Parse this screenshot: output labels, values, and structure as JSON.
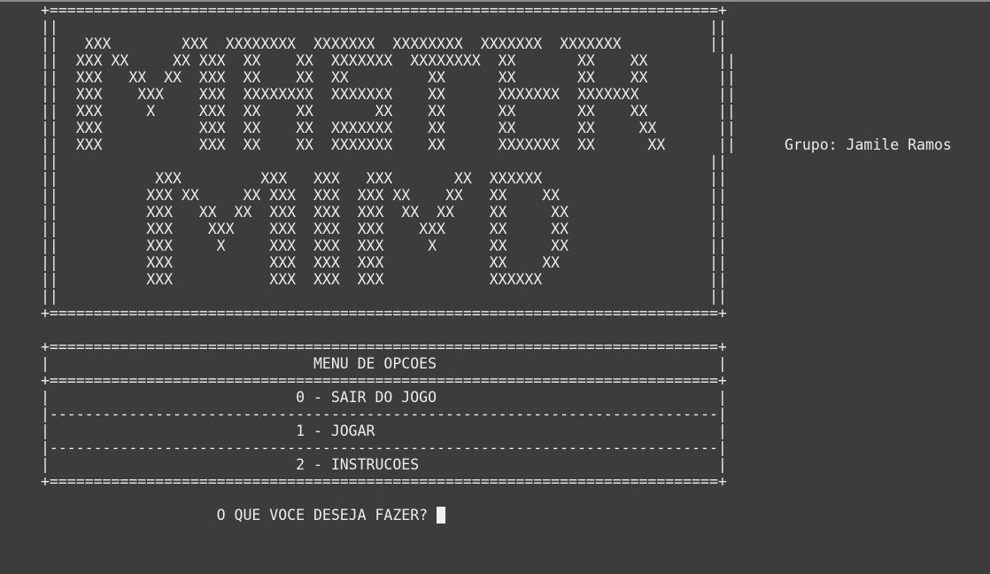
{
  "group_label": "Grupo: Jamile Ramos",
  "banner": {
    "lines": [
      "+============================================================================+",
      "||                                                                          ||",
      "||   XXX        XXX  XXXXXXXX  XXXXXXX  XXXXXXXX  XXXXXXX  XXXXXXX          ||",
      "||  XXX XX     XX XXX  XX    XX  XXXXXXX  XXXXXXXX  XX       XX    XX        ||",
      "||  XXX   XX  XX  XXX  XX    XX  XX         XX      XX       XX    XX        ||",
      "||  XXX    XXX    XXX  XXXXXXXX  XXXXXXX    XX      XXXXXXX  XXXXXXX         ||",
      "||  XXX     X     XXX  XX    XX       XX    XX      XX       XX    XX        ||",
      "||  XXX           XXX  XX    XX  XXXXXXX    XX      XX       XX     XX       ||",
      "||  XXX           XXX  XX    XX  XXXXXXX    XX      XXXXXXX  XX      XX      ||",
      "||                                                                          ||",
      "||           XXX         XXX   XXX   XXX       XX  XXXXXX                   ||",
      "||          XXX XX     XX XXX  XXX  XXX XX    XX   XX    XX                 ||",
      "||          XXX   XX  XX  XXX  XXX  XXX  XX  XX    XX     XX                ||",
      "||          XXX    XXX    XXX  XXX  XXX    XXX     XX     XX                ||",
      "||          XXX     X     XXX  XXX  XXX     X      XX     XX                ||",
      "||          XXX           XXX  XXX  XXX            XX    XX                 ||",
      "||          XXX           XXX  XXX  XXX            XXXXXX                   ||",
      "||                                                                          ||",
      "+============================================================================+"
    ]
  },
  "menu": {
    "top_border": "+============================================================================+",
    "title_line": "|                              MENU DE OPCOES                                |",
    "mid_border": "+============================================================================+",
    "option_0": "|                            0 - SAIR DO JOGO                                |",
    "separator_1": "|----------------------------------------------------------------------------|",
    "option_1": "|                            1 - JOGAR                                       |",
    "separator_2": "|----------------------------------------------------------------------------|",
    "option_2": "|                            2 - INSTRUCOES                                  |",
    "bottom_border": "+============================================================================+"
  },
  "prompt": {
    "text": "                    O QUE VOCE DESEJA FAZER? "
  }
}
